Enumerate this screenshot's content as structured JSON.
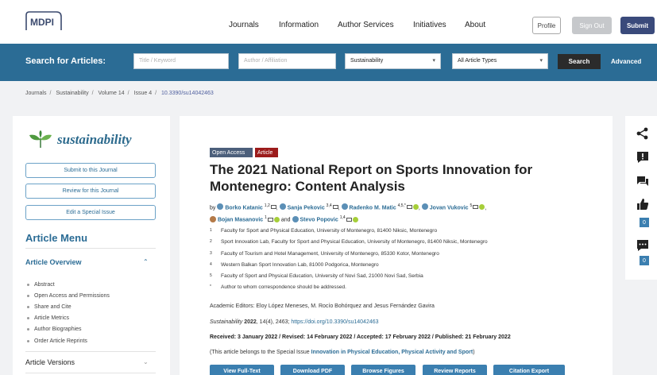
{
  "header": {
    "logo_text": "MDPI",
    "nav": [
      "Journals",
      "Information",
      "Author Services",
      "Initiatives",
      "About"
    ],
    "profile_label": "Profile",
    "signout_label": "Sign Out",
    "submit_label": "Submit"
  },
  "search": {
    "label": "Search for Articles:",
    "keyword_placeholder": "Title / Keyword",
    "author_placeholder": "Author / Affiliation",
    "journal_value": "Sustainability",
    "type_value": "All Article Types",
    "search_button": "Search",
    "advanced_label": "Advanced"
  },
  "breadcrumb": [
    "Journals",
    "Sustainability",
    "Volume 14",
    "Issue 4",
    "10.3390/su14042463"
  ],
  "sidebar": {
    "journal_name": "sustainability",
    "buttons": [
      "Submit to this Journal",
      "Review for this Journal",
      "Edit a Special Issue"
    ],
    "menu_title": "Article Menu",
    "overview_title": "Article Overview",
    "overview_items": [
      "Abstract",
      "Open Access and Permissions",
      "Share and Cite",
      "Article Metrics",
      "Author Biographies",
      "Order Article Reprints"
    ],
    "versions_title": "Article Versions"
  },
  "article": {
    "badge_oa": "Open Access",
    "badge_type": "Article",
    "title": "The 2021 National Report on Sports Innovation for Montenegro: Content Analysis",
    "by": "by",
    "authors": [
      {
        "name": "Borko Katanic",
        "sup": "1,2"
      },
      {
        "name": "Sanja Pekovic",
        "sup": "3,4"
      },
      {
        "name": "Radenko M. Matic",
        "sup": "4,5,*"
      },
      {
        "name": "Jovan Vukovic",
        "sup": "5"
      },
      {
        "name": "Bojan Masanovic",
        "sup": "1"
      },
      {
        "name": "Stevo Popovic",
        "sup": "1,4"
      }
    ],
    "and": "and",
    "affiliations": [
      {
        "num": "1",
        "text": "Faculty for Sport and Physical Education, University of Montenegro, 81400 Niksic, Montenegro"
      },
      {
        "num": "2",
        "text": "Sport Innovation Lab, Faculty for Sport and Physical Education, University of Montenegro, 81400 Niksic, Montenegro"
      },
      {
        "num": "3",
        "text": "Faculty of Tourism and Hotel Management, University of Montenegro, 85330 Kotor, Montenegro"
      },
      {
        "num": "4",
        "text": "Western Balkan Sport Innovation Lab, 81000 Podgorica, Montenegro"
      },
      {
        "num": "5",
        "text": "Faculty of Sport and Physical Education, University of Novi Sad, 21000 Novi Sad, Serbia"
      },
      {
        "num": "*",
        "text": "Author to whom correspondence should be addressed."
      }
    ],
    "editors": "Academic Editors: Eloy López Meneses, M. Rocío Bohórquez and Jesus Fernández Gavira",
    "citation_journal": "Sustainability",
    "citation_year": "2022",
    "citation_rest": ", 14(4), 2463;",
    "citation_doi": "https://doi.org/10.3390/su14042463",
    "dates": "Received: 3 January 2022 / Revised: 14 February 2022 / Accepted: 17 February 2022 / Published: 21 February 2022",
    "special_prefix": "(This article belongs to the Special Issue",
    "special_issue": "Innovation in Physical Education, Physical Activity and Sport",
    "special_suffix": ")",
    "actions": [
      "View Full-Text",
      "Download PDF",
      "Browse Figures",
      "Review Reports",
      "Citation Export"
    ]
  },
  "rail": {
    "like_count": "0",
    "comment_count": "0",
    "icons": [
      "share-icon",
      "report-icon",
      "chat-icon",
      "thumbs-up-icon",
      "comment-icon"
    ]
  }
}
